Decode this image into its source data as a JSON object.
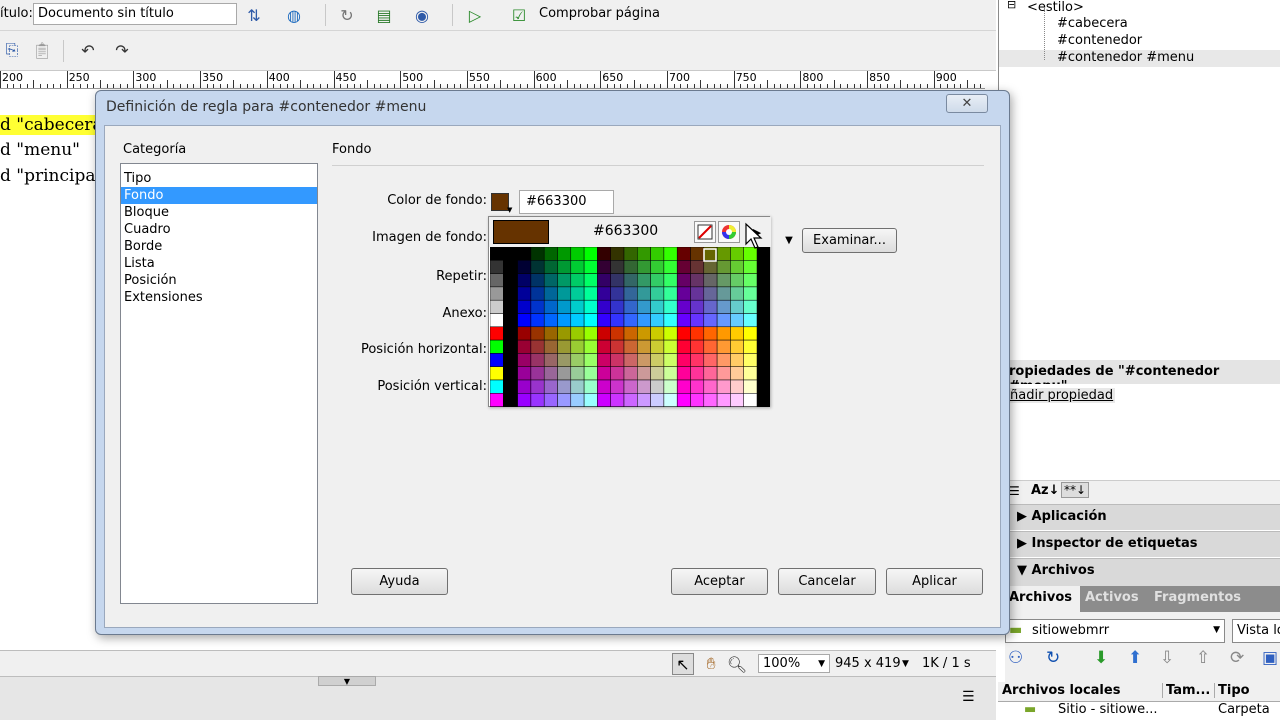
{
  "document": {
    "title_label": "ítulo:",
    "title_value": "Documento sin título",
    "check_page_label": "Comprobar página",
    "ruler_marks": [
      "200",
      "250",
      "300",
      "350",
      "400",
      "450",
      "500",
      "550",
      "600",
      "650",
      "700",
      "750",
      "800",
      "850",
      "900"
    ],
    "body_lines": [
      "d \"cabecera",
      "d \"menu\"",
      "d \"principal\""
    ]
  },
  "status_bar": {
    "zoom": "100%",
    "dimensions": "945 x 419",
    "size_time": "1K / 1 s"
  },
  "css_panel": {
    "tree": [
      "<estilo>",
      "#cabecera",
      "#contenedor",
      "#contenedor #menu"
    ],
    "properties_title": "ropiedades de \"#contenedor #menu\"",
    "add_property": "ñadir propiedad"
  },
  "panels": {
    "application": "Aplicación",
    "tag_inspector": "Inspector de etiquetas",
    "files": "Archivos"
  },
  "files_panel": {
    "tabs": [
      "Archivos",
      "Activos",
      "Fragmentos"
    ],
    "site": "sitiowebmrr",
    "view": "Vista lo",
    "columns": [
      "Archivos locales",
      "Tam...",
      "Tipo"
    ],
    "row": {
      "name": "Sitio - sitiowe...",
      "type": "Carpeta"
    }
  },
  "dialog": {
    "title": "Definición de regla para #contenedor #menu",
    "close_symbol": "✕",
    "category_title": "Categoría",
    "categories": [
      "Tipo",
      "Fondo",
      "Bloque",
      "Cuadro",
      "Borde",
      "Lista",
      "Posición",
      "Extensiones"
    ],
    "selected_category": "Fondo",
    "section_title": "Fondo",
    "labels": {
      "bg_color": "Color de fondo:",
      "bg_image": "Imagen de fondo:",
      "repeat": "Repetir:",
      "attachment": "Anexo:",
      "pos_h": "Posición horizontal:",
      "pos_v": "Posición vertical:"
    },
    "bg_color_value": "#663300",
    "browse_button": "Examinar...",
    "help_button": "Ayuda",
    "ok_button": "Aceptar",
    "cancel_button": "Cancelar",
    "apply_button": "Aplicar"
  },
  "color_picker": {
    "hex": "#663300",
    "preview_color": "#663300"
  }
}
